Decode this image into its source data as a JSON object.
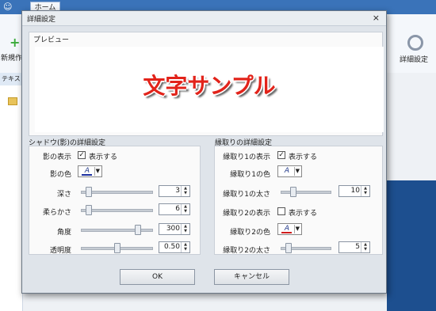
{
  "app": {
    "tab_home": "ホーム",
    "new_label": "新規作",
    "detail_label": "詳細設定",
    "panel_head": "テキスト・"
  },
  "dialog": {
    "title": "詳細設定",
    "close": "×",
    "preview_label": "プレビュー",
    "sample_text": "文字サンプル",
    "shadow": {
      "group_label": "シャドウ(影)の詳細設定",
      "show_label": "影の表示",
      "show_checked": true,
      "show_text": "表示する",
      "color_label": "影の色",
      "color_glyph": "A",
      "color_bar": "#1c2fa0",
      "depth_label": "深さ",
      "depth_value": "3",
      "depth_fraction": 0.06,
      "soft_label": "柔らかさ",
      "soft_value": "6",
      "soft_fraction": 0.06,
      "angle_label": "角度",
      "angle_value": "300",
      "angle_fraction": 0.83,
      "opacity_label": "透明度",
      "opacity_value": "0.50",
      "opacity_fraction": 0.5
    },
    "outline": {
      "group_label": "縁取りの詳細設定",
      "o1_show_label": "縁取り1の表示",
      "o1_checked": true,
      "o1_show_text": "表示する",
      "o1_color_label": "縁取り1の色",
      "o1_color_glyph": "A",
      "o1_color_bar": "#ffffff",
      "o1_width_label": "縁取り1の太さ",
      "o1_width_value": "10",
      "o1_width_fraction": 0.2,
      "o2_show_label": "縁取り2の表示",
      "o2_checked": false,
      "o2_show_text": "表示する",
      "o2_color_label": "縁取り2の色",
      "o2_color_glyph": "A",
      "o2_color_bar": "#d01c1c",
      "o2_width_label": "縁取り2の太さ",
      "o2_width_value": "5",
      "o2_width_fraction": 0.1
    },
    "ok_label": "OK",
    "cancel_label": "キャンセル"
  }
}
